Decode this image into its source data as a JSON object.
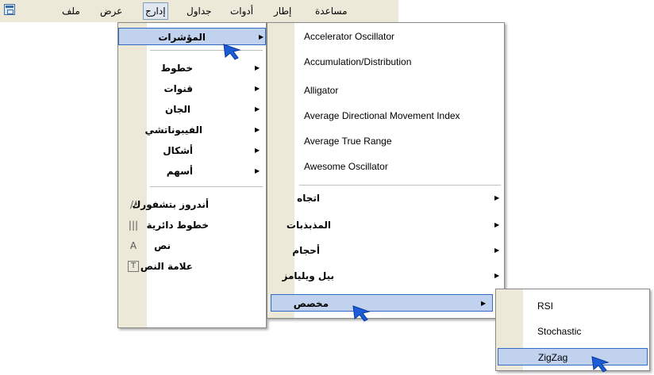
{
  "menubar": {
    "items": [
      "مساعدة",
      "إطار",
      "أدوات",
      "جداول",
      "إدارج",
      "عرض",
      "ملف"
    ]
  },
  "insert_menu": {
    "top_item": "المؤشرات",
    "group1": [
      "خطوط",
      "قنوات",
      "الجان",
      "الفيبوناتشي",
      "أشكال",
      "أسهم"
    ],
    "group2": [
      "أندروز بتشفورك",
      "خطوط دائرية",
      "نص",
      "علامة النص"
    ],
    "icon_glyphs": [
      "//",
      "|||",
      "A",
      "T"
    ]
  },
  "indicators_menu": {
    "items": [
      "Accelerator Oscillator",
      "Accumulation/Distribution",
      "Alligator",
      "Average Directional Movement Index",
      "Average True Range",
      "Awesome Oscillator"
    ],
    "submenus": [
      "اتجاه",
      "المذبذبات",
      "أحجام",
      "بيل ويليامز"
    ],
    "custom": "مخصص"
  },
  "custom_menu": {
    "items": [
      "RSI",
      "Stochastic",
      "ZigZag"
    ]
  },
  "colors": {
    "highlight": "#c1d2ee",
    "highlight_border": "#316ac5",
    "menubar_bg": "#ece9d8",
    "cursor": "#1e5bd6"
  }
}
